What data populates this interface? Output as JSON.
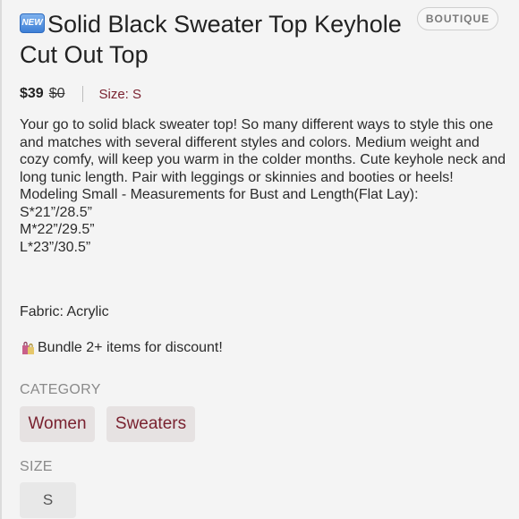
{
  "listing": {
    "new_badge": "NEW",
    "title": "Solid Black Sweater Top Keyhole Cut Out Top",
    "boutique_label": "BOUTIQUE",
    "price": "$39",
    "original_price": "$0",
    "size_text": "Size: S",
    "description": "Your go to solid black sweater top! So many different ways to style this one and matches with several different styles and colors. Medium weight and cozy comfy, will keep you warm in the colder months. Cute keyhole neck and long tunic length. Pair with leggings or skinnies and booties or heels! Modeling Small - Measurements for Bust and Length(Flat Lay):\nS*21”/28.5”\nM*22”/29.5”\nL*23”/30.5”",
    "fabric": "Fabric: Acrylic",
    "bundle": "Bundle 2+ items for discount!"
  },
  "category": {
    "label": "CATEGORY",
    "chips": [
      "Women",
      "Sweaters"
    ]
  },
  "size": {
    "label": "SIZE",
    "value": "S"
  },
  "icons": {
    "new": "new-badge-icon",
    "bag": "shopping-bags-icon"
  },
  "colors": {
    "accent": "#7a2230",
    "chip_bg": "#e6e2e2"
  }
}
